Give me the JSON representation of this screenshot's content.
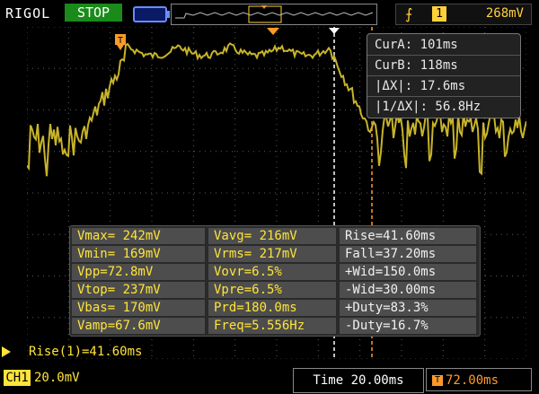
{
  "top": {
    "brand": "RIGOL",
    "run_state": "STOP",
    "trigger_source": "1",
    "trigger_level": "268mV"
  },
  "cursors": {
    "cur_a": "CurA: 101ms",
    "cur_b": "CurB: 118ms",
    "delta_x": "|ΔX|: 17.6ms",
    "inv_delta_x": "|1/ΔX|: 56.8Hz"
  },
  "measurements": {
    "col1": [
      "Vmax= 242mV",
      "Vmin= 169mV",
      "Vpp=72.8mV",
      "Vtop= 237mV",
      "Vbas= 170mV",
      "Vamp=67.6mV"
    ],
    "col2": [
      "Vavg= 216mV",
      "Vrms= 217mV",
      "Vovr=6.5%",
      "Vpre=6.5%",
      "Prd=180.0ms",
      "Freq=5.556Hz"
    ],
    "col3": [
      "Rise=41.60ms",
      "Fall=37.20ms",
      "+Wid=150.0ms",
      "-Wid=30.00ms",
      "+Duty=83.3%",
      "-Duty=16.7%"
    ]
  },
  "rise_readout": "Rise(1)=41.60ms",
  "bottom": {
    "channel": "CH1",
    "channel_scale": "20.0mV",
    "timebase": "Time 20.00ms",
    "trigger_position": "72.00ms",
    "trigger_position_icon": "T"
  },
  "colors": {
    "trace": "#c8b428",
    "grid": "#5a5a5a",
    "cursor_a": "#ffffff",
    "cursor_b": "#ff9a2a",
    "channel": "#ffe43a"
  },
  "icons": {
    "trigger_edge": "rising-edge-icon",
    "battery": "battery-icon",
    "trigger_marker": "trigger-marker-icon"
  }
}
